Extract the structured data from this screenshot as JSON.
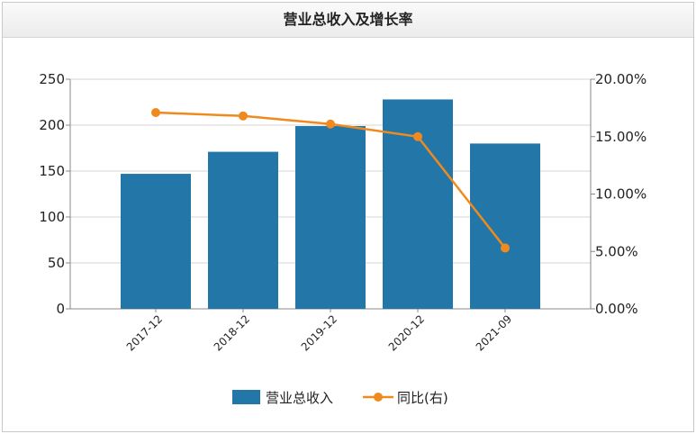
{
  "chart_data": {
    "type": "bar",
    "title": "营业总收入及增长率",
    "categories": [
      "2017-12",
      "2018-12",
      "2019-12",
      "2020-12",
      "2021-09"
    ],
    "series": [
      {
        "name": "营业总收入",
        "type": "bar",
        "axis": "left",
        "color": "#2276a8",
        "values": [
          147,
          171,
          199,
          228,
          180
        ]
      },
      {
        "name": "同比(右)",
        "type": "line",
        "axis": "right",
        "color": "#f08a1e",
        "values": [
          17.1,
          16.8,
          16.1,
          15.0,
          5.3
        ]
      }
    ],
    "y_left": {
      "ylim": [
        0,
        250
      ],
      "ticks": [
        "0",
        "50",
        "100",
        "150",
        "200",
        "250"
      ]
    },
    "y_right": {
      "ylim": [
        0,
        20
      ],
      "ticks": [
        "0.00%",
        "5.00%",
        "10.00%",
        "15.00%",
        "20.00%"
      ]
    },
    "grid": true,
    "legend": "bottom"
  }
}
